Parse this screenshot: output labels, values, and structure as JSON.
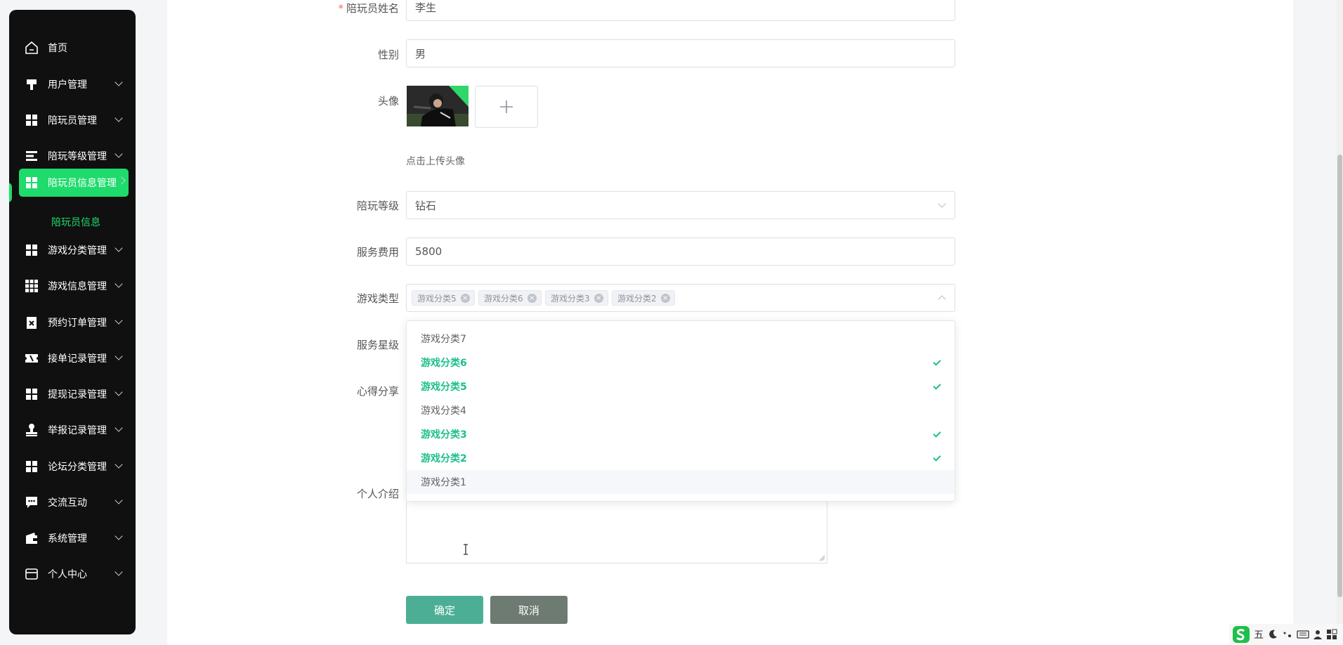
{
  "sidebar": {
    "items": [
      {
        "label": "首页",
        "icon": "home-icon"
      },
      {
        "label": "用户管理",
        "icon": "user-brush-icon"
      },
      {
        "label": "陪玩员管理",
        "icon": "grid-icon"
      },
      {
        "label": "陪玩等级管理",
        "icon": "list-icon"
      },
      {
        "label": "陪玩员信息管理",
        "icon": "grid-icon"
      },
      {
        "label": "游戏分类管理",
        "icon": "grid-icon"
      },
      {
        "label": "游戏信息管理",
        "icon": "dots-grid-icon"
      },
      {
        "label": "预约订单管理",
        "icon": "clipboard-icon"
      },
      {
        "label": "接单记录管理",
        "icon": "ticket-icon"
      },
      {
        "label": "提现记录管理",
        "icon": "grid-icon"
      },
      {
        "label": "举报记录管理",
        "icon": "stamp-icon"
      },
      {
        "label": "论坛分类管理",
        "icon": "grid-icon"
      },
      {
        "label": "交流互动",
        "icon": "chat-icon"
      },
      {
        "label": "系统管理",
        "icon": "wallet-icon"
      },
      {
        "label": "个人中心",
        "icon": "card-icon"
      }
    ],
    "submenu_label": "陪玩员信息"
  },
  "form": {
    "name_label": "陪玩员姓名",
    "name_value": "李生",
    "gender_label": "性别",
    "gender_value": "男",
    "avatar_label": "头像",
    "upload_hint": "点击上传头像",
    "level_label": "陪玩等级",
    "level_value": "钻石",
    "fee_label": "服务费用",
    "fee_value": "5800",
    "game_type_label": "游戏类型",
    "game_type_tags": [
      "游戏分类5",
      "游戏分类6",
      "游戏分类3",
      "游戏分类2"
    ],
    "star_label": "服务星级",
    "share_label": "心得分享",
    "intro_label": "个人介绍",
    "confirm_label": "确定",
    "cancel_label": "取消"
  },
  "dropdown": {
    "options": [
      {
        "label": "游戏分类7",
        "selected": false
      },
      {
        "label": "游戏分类6",
        "selected": true
      },
      {
        "label": "游戏分类5",
        "selected": true
      },
      {
        "label": "游戏分类4",
        "selected": false
      },
      {
        "label": "游戏分类3",
        "selected": true
      },
      {
        "label": "游戏分类2",
        "selected": true
      },
      {
        "label": "游戏分类1",
        "selected": false
      }
    ]
  },
  "tray": {
    "ime_label": "五"
  },
  "colors": {
    "accent": "#1fdb6c",
    "selected_option": "#1bbf8c",
    "confirm_button": "#4caf95",
    "cancel_button": "#6d7b72",
    "sidebar_bg": "#101010"
  }
}
